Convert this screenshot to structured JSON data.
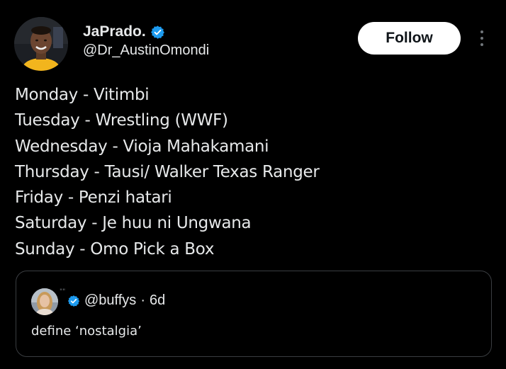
{
  "author": {
    "display_name": "JaPrado.",
    "handle": "@Dr_AustinOmondi",
    "verified": true,
    "verified_color": "#1d9bf0"
  },
  "actions": {
    "follow_label": "Follow",
    "more_icon": "more-vertical-icon"
  },
  "tweet": {
    "lines": [
      "Monday - Vitimbi",
      "Tuesday - Wrestling (WWF)",
      "Wednesday - Vioja Mahakamani",
      "Thursday - Tausi/ Walker Texas Ranger",
      "Friday - Penzi hatari",
      "Saturday - Je huu ni Ungwana",
      "Sunday - Omo Pick a Box"
    ]
  },
  "quote": {
    "extra_mark": "\"\"",
    "handle": "@buffys",
    "separator": "·",
    "age": "6d",
    "text": "define ‘nostalgia’",
    "verified": true
  },
  "colors": {
    "background": "#000000",
    "text": "#e7e9ea",
    "muted": "#71767b",
    "border": "#3a3d41",
    "accent": "#1d9bf0"
  }
}
